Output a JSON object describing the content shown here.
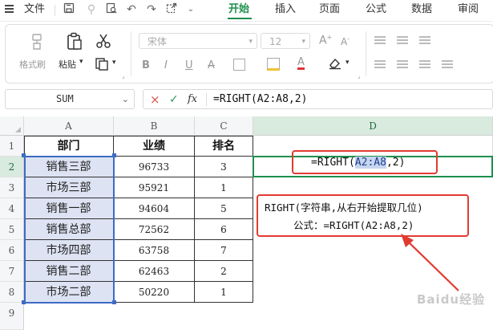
{
  "menu": {
    "file_label": "文件",
    "tabs": [
      "开始",
      "插入",
      "页面",
      "公式",
      "数据",
      "审阅"
    ],
    "active_tab": "开始"
  },
  "ribbon": {
    "format_painter": "格式刷",
    "paste": "粘贴",
    "font_name": "宋体",
    "font_size": "12"
  },
  "formula_bar": {
    "name_box": "SUM",
    "cancel_icon": "×",
    "confirm_icon": "✓",
    "fx": "fx",
    "formula": "=RIGHT(A2:A8,2)"
  },
  "sheet": {
    "columns": [
      "A",
      "B",
      "C",
      "D"
    ],
    "rows": [
      "1",
      "2",
      "3",
      "4",
      "5",
      "6",
      "7",
      "8",
      "9"
    ],
    "headers": [
      "部门",
      "业绩",
      "排名"
    ],
    "data": [
      [
        "销售三部",
        "96733",
        "3"
      ],
      [
        "市场三部",
        "95921",
        "1"
      ],
      [
        "销售一部",
        "94604",
        "5"
      ],
      [
        "销售总部",
        "72562",
        "6"
      ],
      [
        "市场四部",
        "63758",
        "7"
      ],
      [
        "销售二部",
        "62463",
        "2"
      ],
      [
        "市场二部",
        "50220",
        "1"
      ]
    ],
    "d2_formula": {
      "prefix": "=RIGHT(",
      "ref": "A2:A8",
      "suffix": ",2)"
    }
  },
  "annotation": {
    "line1": "RIGHT(字符串,从右开始提取几位)",
    "line2": "公式：=RIGHT(A2:A8,2)"
  },
  "watermark": "Baidu经验",
  "colors": {
    "accent": "#1e8f4e",
    "annotation_red": "#e13b31",
    "selection_fill": "#dde3f3"
  }
}
